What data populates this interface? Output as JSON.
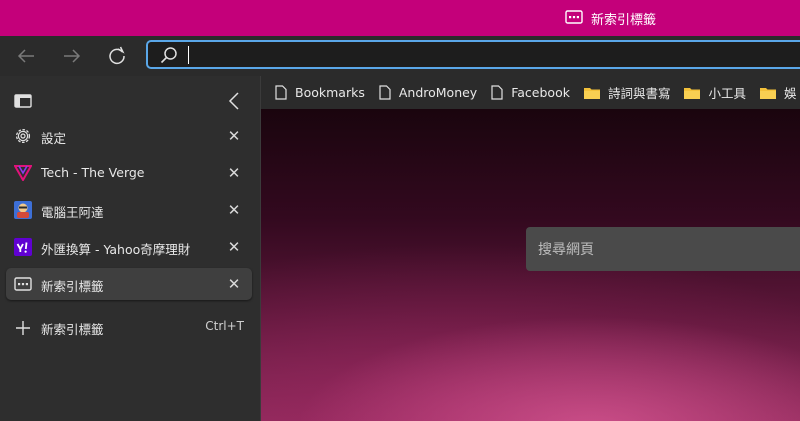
{
  "window": {
    "title": "新索引標籤",
    "accent_color": "#c4007a"
  },
  "toolbar": {
    "back_icon": "arrow-left-icon",
    "forward_icon": "arrow-right-icon",
    "reload_icon": "reload-icon",
    "address_value": "",
    "address_icon": "search-icon"
  },
  "sidebar": {
    "panel_icon": "sidebar-panel-icon",
    "collapse_icon": "chevron-left-icon",
    "tabs": [
      {
        "label": "設定",
        "icon": "gear-icon",
        "active": false
      },
      {
        "label": "Tech - The Verge",
        "icon": "verge-logo-icon",
        "active": false
      },
      {
        "label": "電腦王阿達",
        "icon": "site-favicon-icon",
        "active": false
      },
      {
        "label": "外匯換算 - Yahoo奇摩理財",
        "icon": "yahoo-logo-icon",
        "active": false
      },
      {
        "label": "新索引標籤",
        "icon": "new-tab-page-icon",
        "active": true
      }
    ],
    "new_tab": {
      "label": "新索引標籤",
      "shortcut": "Ctrl+T",
      "icon": "plus-icon"
    },
    "close_glyph": "✕"
  },
  "bookmarks": [
    {
      "label": "Bookmarks",
      "icon": "page-icon"
    },
    {
      "label": "AndroMoney",
      "icon": "page-icon"
    },
    {
      "label": "Facebook",
      "icon": "page-icon"
    },
    {
      "label": "詩詞與書寫",
      "icon": "folder-icon"
    },
    {
      "label": "小工具",
      "icon": "folder-icon"
    },
    {
      "label": "娛",
      "icon": "folder-icon"
    }
  ],
  "page": {
    "search_placeholder": "搜尋網頁"
  }
}
